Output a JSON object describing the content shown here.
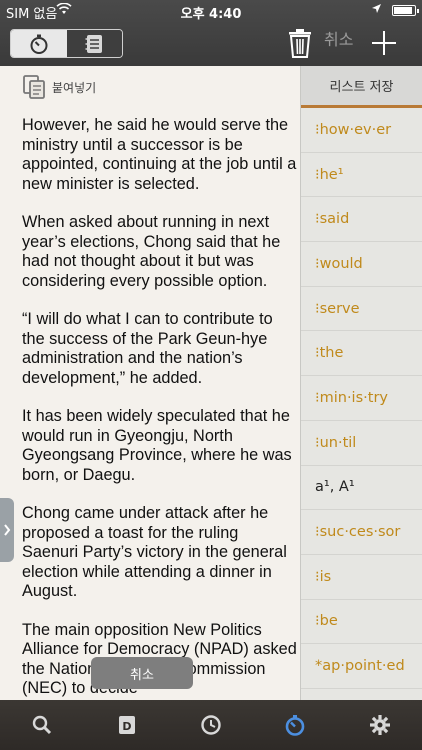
{
  "status": {
    "carrier": "SIM 없음",
    "time": "오후 4:40",
    "battery_level": 0.9
  },
  "toolbar": {
    "cancel_label": "취소"
  },
  "paste": {
    "label": "붙여넣기"
  },
  "article": {
    "paragraphs": [
      "However, he said he would serve the ministry until a successor is be appointed, continuing at the job until a new minister is selected.",
      "When asked about running in next year’s elections, Chong said that he had not thought about it but was considering every possible option.",
      "“I will do what I can to contribute to the success of the Park Geun-hye administration and the nation’s development,” he added.",
      "It has been widely speculated that he would run in Gyeongju, North Gyeongsang Province, where he was born, or Daegu.",
      "Chong came under attack after he proposed a toast for the ruling Saenuri Party’s victory in the general election while attending a dinner in August.",
      "The main opposition New Politics Alliance for Democracy (NPAD) asked the National Election Commission (NEC) to decide"
    ]
  },
  "sidebar": {
    "header": "리스트 저장",
    "items": [
      "⁝how·ev·er",
      "⁝he¹",
      "⁝said",
      "⁝would",
      "⁝serve",
      "⁝the",
      "⁝min·is·try",
      "⁝un·til",
      "a¹, A¹",
      "⁝suc·ces·sor",
      "⁝is",
      "⁝be",
      "*ap·point·ed"
    ]
  },
  "toast": {
    "label": "취소"
  },
  "colors": {
    "accent": "#c08a1c",
    "toolbar": "#3e3e3e",
    "bottom": "#302c29"
  }
}
